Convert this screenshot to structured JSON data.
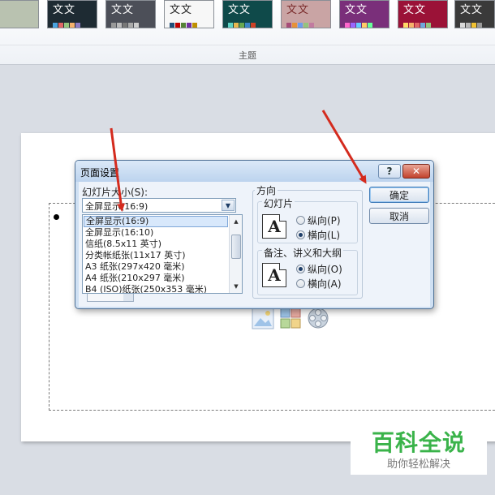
{
  "ribbon": {
    "group_label": "主题",
    "themes": [
      {
        "text": "",
        "bg": "#b9c2b0"
      },
      {
        "text": "文文",
        "bg": "#1e2b33"
      },
      {
        "text": "文文",
        "bg": "#4c4f58"
      },
      {
        "text": "文文",
        "bg": "#f7f7f7"
      },
      {
        "text": "文文",
        "bg": "#0f4a4a"
      },
      {
        "text": "文文",
        "bg": "#c9a4a4"
      },
      {
        "text": "文文",
        "bg": "#7a2f7a"
      },
      {
        "text": "文文",
        "bg": "#9b1237"
      },
      {
        "text": "文文",
        "bg": "#3a3a3a"
      }
    ]
  },
  "dialog": {
    "title": "页面设置",
    "help_label": "?",
    "close_label": "✕",
    "size_label": "幻灯片大小(S):",
    "size_selected": "全屏显示(16:9)",
    "size_options": [
      "全屏显示(16:9)",
      "全屏显示(16:10)",
      "信纸(8.5x11 英寸)",
      "分类帐纸张(11x17 英寸)",
      "A3 纸张(297x420 毫米)",
      "A4 纸张(210x297 毫米)",
      "B4 (ISO)纸张(250x353 毫米)"
    ],
    "orientation_label": "方向",
    "slides_group": {
      "title": "幻灯片",
      "icon_letter": "A",
      "portrait": "纵向(P)",
      "landscape": "横向(L)",
      "selected": "landscape"
    },
    "notes_group": {
      "title": "备注、讲义和大纲",
      "icon_letter": "A",
      "portrait": "纵向(O)",
      "landscape": "横向(A)",
      "selected": "portrait"
    },
    "ok_label": "确定",
    "cancel_label": "取消"
  },
  "watermark": {
    "title": "百科全说",
    "subtitle": "助你轻松解决"
  },
  "colors": {
    "annotation_arrow": "#d42b1e",
    "brand_green": "#3ab34a"
  }
}
